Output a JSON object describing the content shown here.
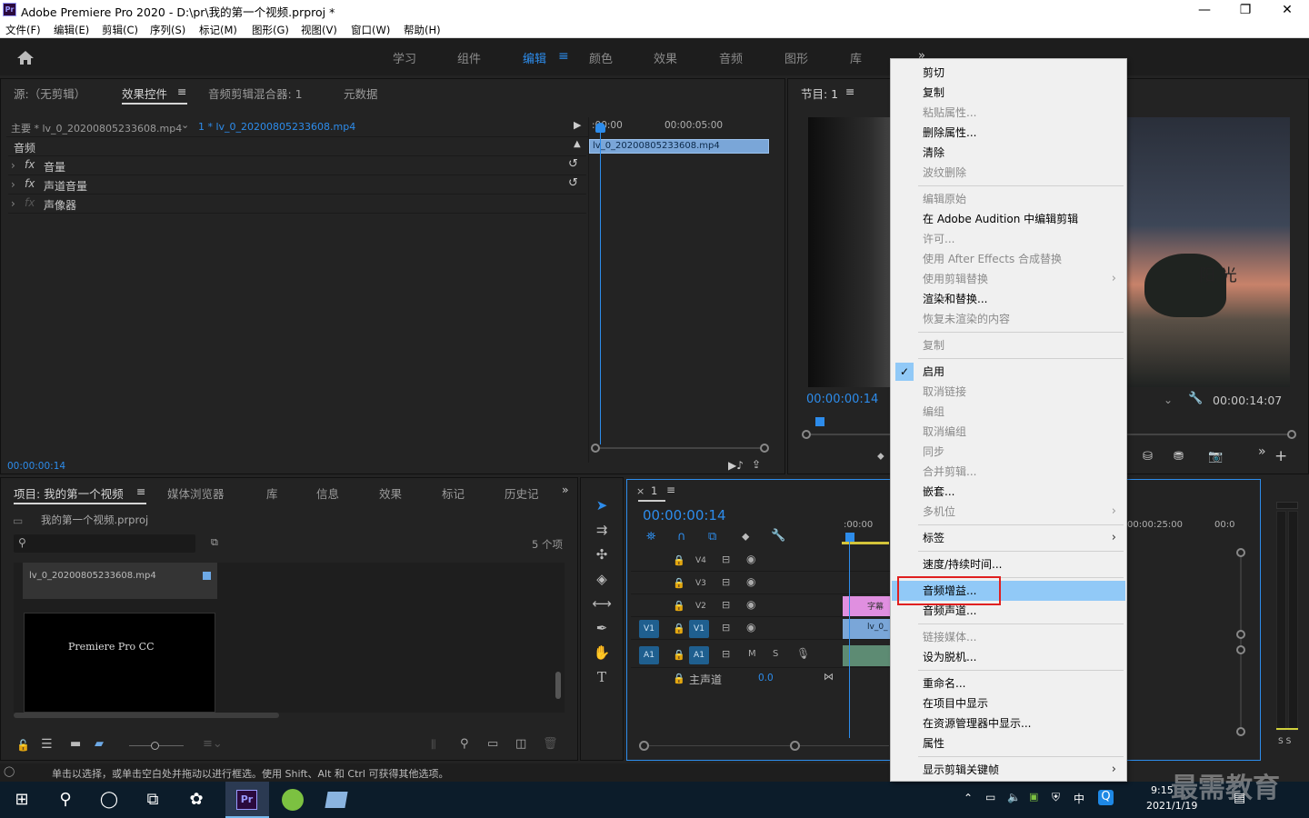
{
  "window": {
    "title": "Adobe Premiere Pro 2020 - D:\\pr\\我的第一个视频.prproj *",
    "logo": "Pr",
    "minimize": "—",
    "maximize": "❐",
    "close": "✕"
  },
  "menu": [
    "文件(F)",
    "编辑(E)",
    "剪辑(C)",
    "序列(S)",
    "标记(M)",
    "图形(G)",
    "视图(V)",
    "窗口(W)",
    "帮助(H)"
  ],
  "workspaces": [
    "学习",
    "组件",
    "编辑",
    "颜色",
    "效果",
    "音频",
    "图形",
    "库"
  ],
  "workspace_more": "»",
  "source_panel": {
    "tabs": [
      "源:（无剪辑）",
      "效果控件",
      "音频剪辑混合器: 1",
      "元数据"
    ],
    "master": "主要 * lv_0_20200805233608.mp4",
    "sequence": "1 * lv_0_20200805233608.mp4",
    "time0": ":00:00",
    "time1": "00:00:05:00",
    "clip": "lv_0_20200805233608.mp4",
    "section": "音频",
    "effects": [
      "音量",
      "声道音量",
      "声像器"
    ],
    "fx": "fx",
    "timecode": "00:00:00:14"
  },
  "program_panel": {
    "title": "节目: 1",
    "timecode": "00:00:00:14",
    "duration": "00:00:14:07",
    "video_text": "阳 光"
  },
  "project_panel": {
    "tabs": [
      "项目: 我的第一个视频",
      "媒体浏览器",
      "库",
      "信息",
      "效果",
      "标记",
      "历史记"
    ],
    "project_file": "我的第一个视频.prproj",
    "item_count": "5 个项",
    "clip_name": "lv_0_20200805233608.mp4",
    "thumb_text": "Premiere Pro CC"
  },
  "timeline": {
    "seq": "1",
    "timecode": "00:00:00:14",
    "ruler": [
      ":00:00",
      "00:00:25:00",
      "00:0"
    ],
    "tracks": [
      "V4",
      "V3",
      "V2",
      "V1",
      "A1"
    ],
    "master": "主声道",
    "master_val": "0.0",
    "clips": {
      "v2": "字幕",
      "v1": "lv_0_"
    },
    "m": "M",
    "s": "S"
  },
  "context_menu": {
    "items": [
      {
        "label": "剪切",
        "enabled": true
      },
      {
        "label": "复制",
        "enabled": true
      },
      {
        "label": "粘贴属性...",
        "enabled": false
      },
      {
        "label": "删除属性...",
        "enabled": true
      },
      {
        "label": "清除",
        "enabled": true
      },
      {
        "label": "波纹删除",
        "enabled": false
      },
      {
        "sep": true
      },
      {
        "label": "编辑原始",
        "enabled": false
      },
      {
        "label": "在 Adobe Audition 中编辑剪辑",
        "enabled": true
      },
      {
        "label": "许可...",
        "enabled": false
      },
      {
        "label": "使用 After Effects 合成替换",
        "enabled": false
      },
      {
        "label": "使用剪辑替换",
        "enabled": false,
        "submenu": true
      },
      {
        "label": "渲染和替换...",
        "enabled": true
      },
      {
        "label": "恢复未渲染的内容",
        "enabled": false
      },
      {
        "sep": true
      },
      {
        "label": "复制",
        "enabled": false
      },
      {
        "sep": true
      },
      {
        "label": "启用",
        "enabled": true,
        "checked": true
      },
      {
        "label": "取消链接",
        "enabled": false
      },
      {
        "label": "编组",
        "enabled": false
      },
      {
        "label": "取消编组",
        "enabled": false
      },
      {
        "label": "同步",
        "enabled": false
      },
      {
        "label": "合并剪辑...",
        "enabled": false
      },
      {
        "label": "嵌套...",
        "enabled": true
      },
      {
        "label": "多机位",
        "enabled": false,
        "submenu": true
      },
      {
        "sep": true
      },
      {
        "label": "标签",
        "enabled": true,
        "submenu": true
      },
      {
        "sep": true
      },
      {
        "label": "速度/持续时间...",
        "enabled": true
      },
      {
        "sep": true
      },
      {
        "label": "音频增益...",
        "enabled": true,
        "highlighted": true
      },
      {
        "label": "音频声道...",
        "enabled": true
      },
      {
        "sep": true
      },
      {
        "label": "链接媒体...",
        "enabled": false
      },
      {
        "label": "设为脱机...",
        "enabled": true
      },
      {
        "sep": true
      },
      {
        "label": "重命名...",
        "enabled": true
      },
      {
        "label": "在项目中显示",
        "enabled": true
      },
      {
        "label": "在资源管理器中显示...",
        "enabled": true
      },
      {
        "label": "属性",
        "enabled": true
      },
      {
        "sep": true
      },
      {
        "label": "显示剪辑关键帧",
        "enabled": true,
        "submenu": true
      }
    ]
  },
  "status_bar": "单击以选择，或单击空白处并拖动以进行框选。使用 Shift、Alt 和 Ctrl 可获得其他选项。",
  "taskbar": {
    "time": "9:15",
    "date": "2021/1/19",
    "ime": "中",
    "watermark": "最需教育"
  },
  "audio_meter": "S S"
}
